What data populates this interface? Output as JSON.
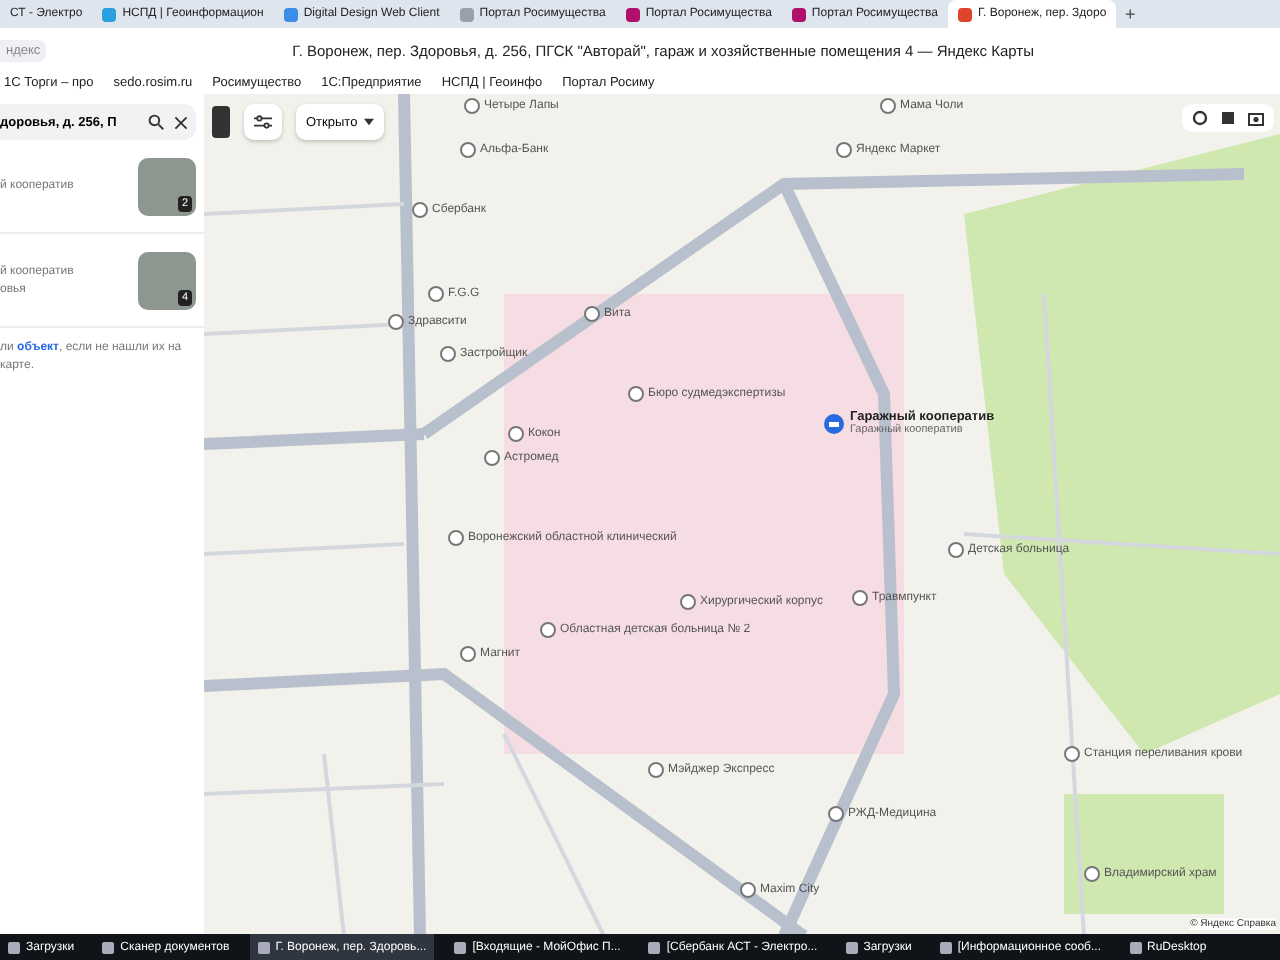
{
  "tabs": [
    {
      "label": "СТ - Электро",
      "selected": false
    },
    {
      "label": "НСПД | Геоинформацион",
      "selected": false
    },
    {
      "label": "Digital Design Web Client",
      "selected": false
    },
    {
      "label": "Портал Росимущества",
      "selected": false
    },
    {
      "label": "Портал Росимущества",
      "selected": false
    },
    {
      "label": "Портал Росимущества",
      "selected": false
    },
    {
      "label": "Г. Воронеж, пер. Здоро",
      "selected": true
    }
  ],
  "new_tab": "+",
  "address": {
    "left": "ндекс",
    "title": "Г. Воронеж, пер. Здоровья, д. 256, ПГСК \"Авторай\", гараж и хозяйственные помещения 4 — Яндекс Карты"
  },
  "bookmarks": [
    "1С Торги – про",
    "sedo.rosim.ru",
    "Росимущество",
    "1С:Предприятие",
    "НСПД | Геоинфо",
    "Портал Росиму"
  ],
  "sidebar": {
    "search": {
      "value": "доровья, д. 256, П"
    },
    "results": [
      {
        "lines": [
          "й кооператив"
        ],
        "photo_count": "2"
      },
      {
        "lines": [
          "й кооператив",
          "овья"
        ],
        "photo_count": "4"
      }
    ],
    "hint": {
      "before": "ли ",
      "link": "объект",
      "after": ", если не нашли их на карте."
    }
  },
  "map": {
    "filter": {
      "label": "Открыто"
    },
    "labels": [
      "Четыре Лапы",
      "Альфа-Банк",
      "Сбербанк",
      "F.G.G",
      "Здравсити",
      "Застройщик",
      "Вита",
      "Бюро судмедэкспертизы",
      "Кокон",
      "Астромед",
      "Воронежский областной клинический",
      "Магнит",
      "Областная детская больница № 2",
      "Хирургический корпус",
      "Травмпункт",
      "Детская больница",
      "Мэйджер Экспресс",
      "РЖД-Медицина",
      "Maxim City",
      "Станция переливания крови",
      "Владимирский храм",
      "Мама Чоли",
      "Яндекс Маркет"
    ],
    "selected_place": {
      "title": "Гаражный кооператив",
      "subtitle": "Гаражный кооператив"
    },
    "copyright": "© Яндекс  Справка"
  },
  "taskbar": [
    {
      "label": "Загрузки",
      "selected": false
    },
    {
      "label": "Сканер документов",
      "selected": false
    },
    {
      "label": "Г. Воронеж, пер. Здоровь...",
      "selected": true
    },
    {
      "label": "[Входящие - МойОфис П...",
      "selected": false
    },
    {
      "label": "[Сбербанк АСТ - Электро...",
      "selected": false
    },
    {
      "label": "Загрузки",
      "selected": false
    },
    {
      "label": "[Информационное сооб...",
      "selected": false
    },
    {
      "label": "RuDesktop",
      "selected": false
    }
  ]
}
